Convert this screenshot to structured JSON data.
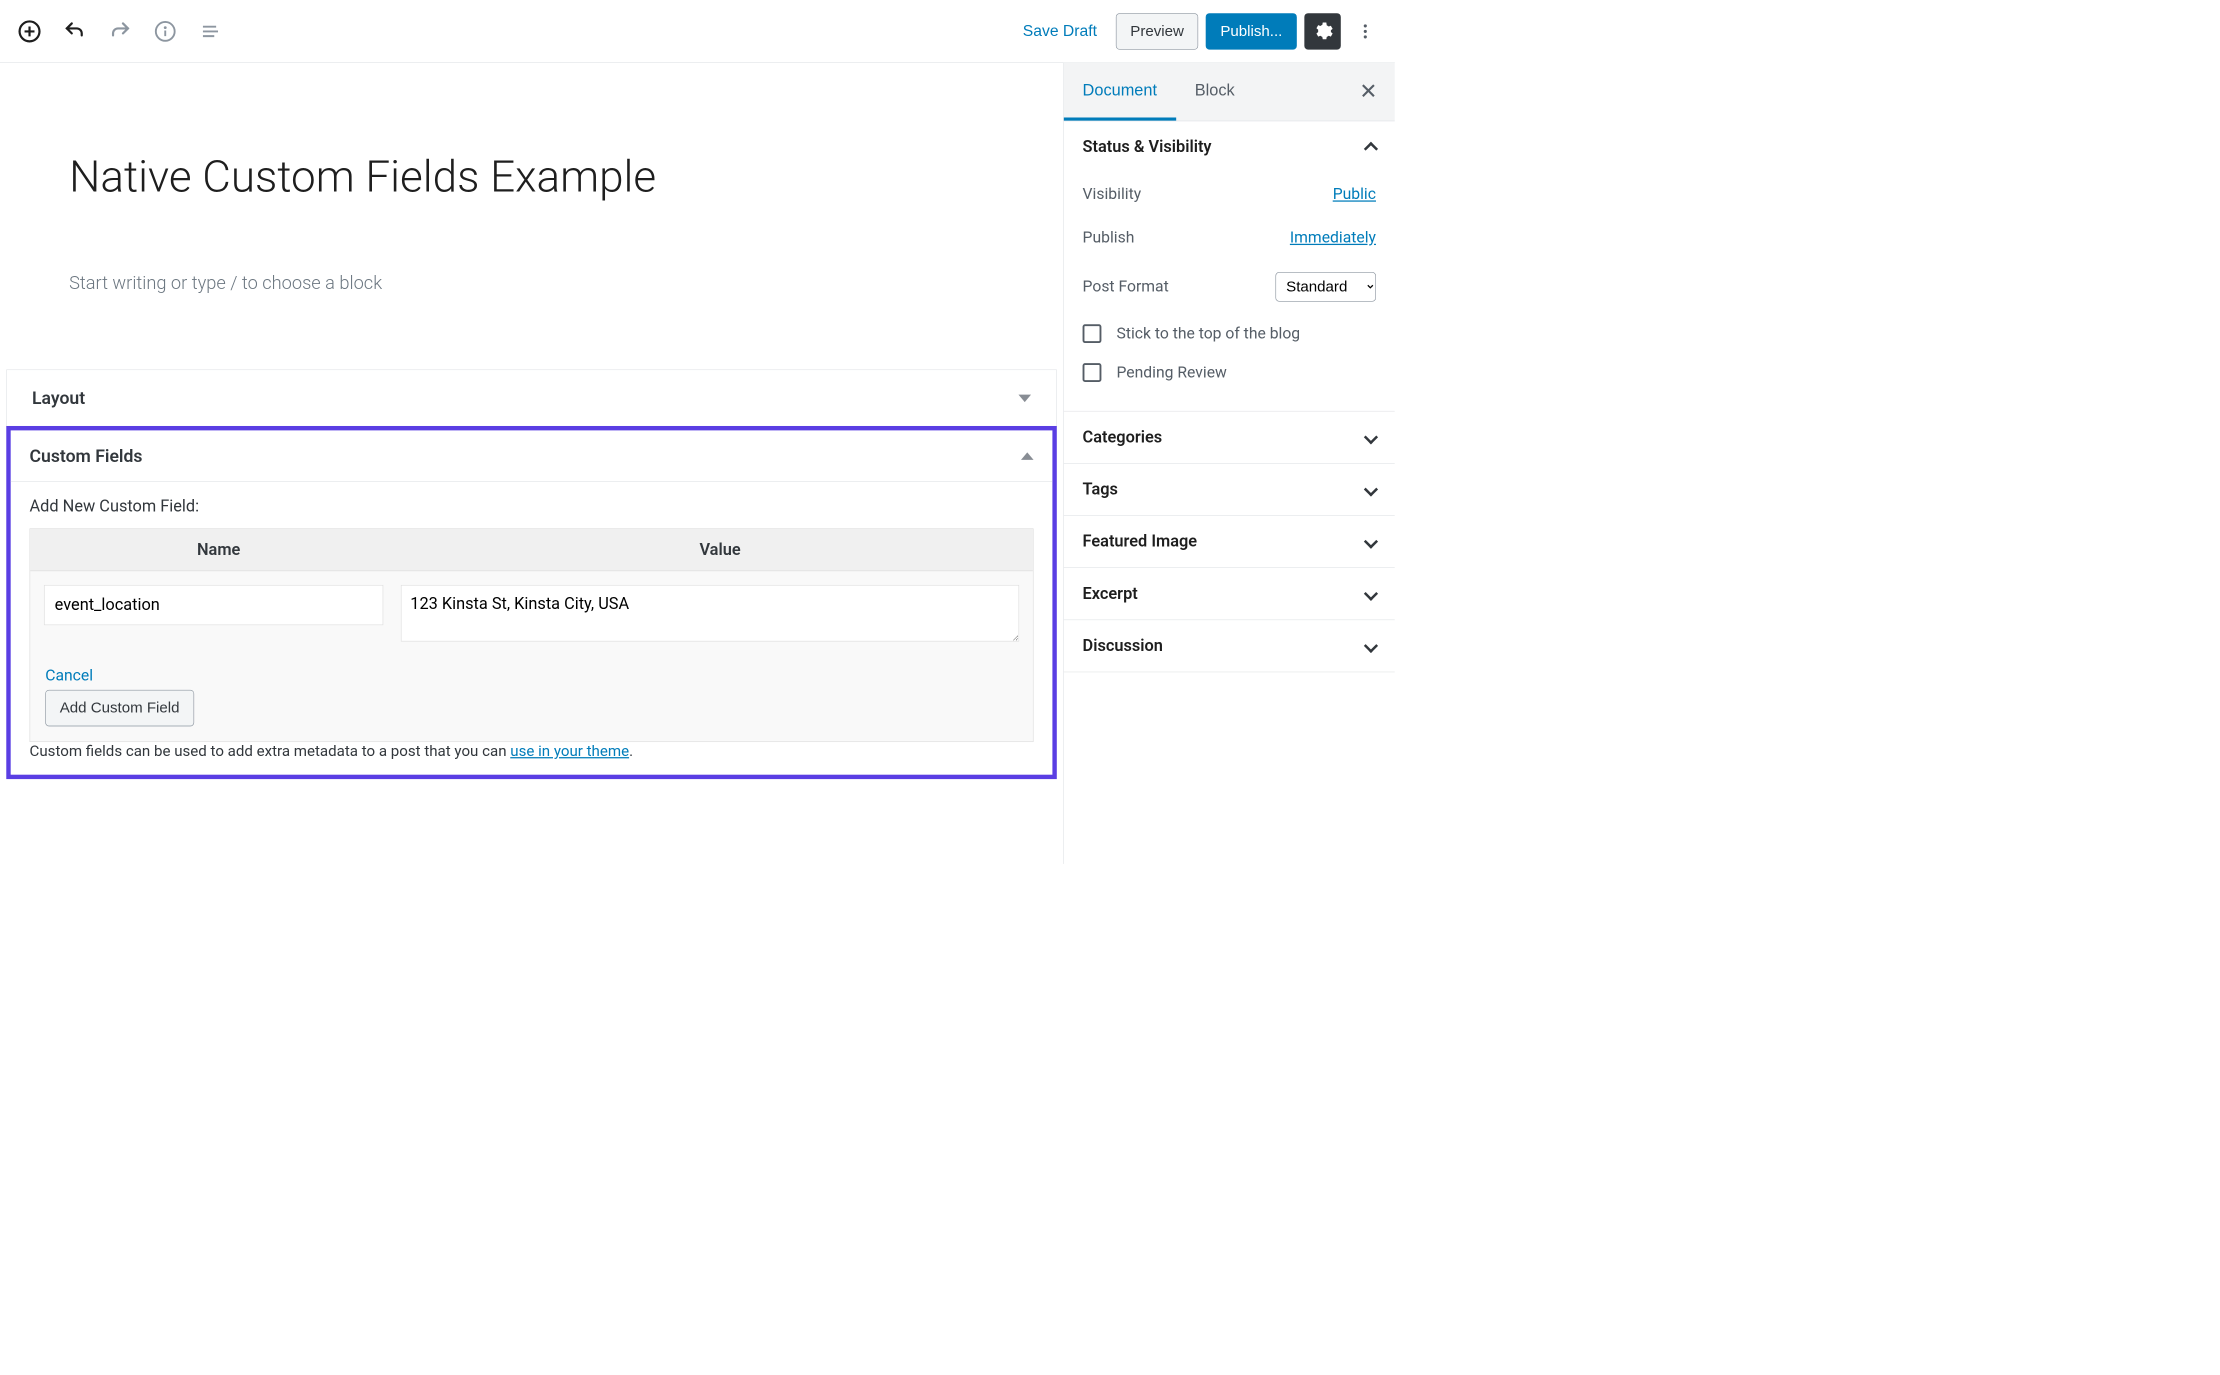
{
  "toolbar": {
    "save_draft": "Save Draft",
    "preview": "Preview",
    "publish": "Publish..."
  },
  "editor": {
    "title": "Native Custom Fields Example",
    "placeholder": "Start writing or type / to choose a block"
  },
  "meta": {
    "layout_label": "Layout",
    "cf_label": "Custom Fields",
    "cf_add_new": "Add New Custom Field:",
    "cf_col_name": "Name",
    "cf_col_value": "Value",
    "cf_name_value": "event_location",
    "cf_value_value": "123 Kinsta St, Kinsta City, USA",
    "cf_cancel": "Cancel",
    "cf_add_button": "Add Custom Field",
    "cf_help_text": "Custom fields can be used to add extra metadata to a post that you can ",
    "cf_help_link": "use in your theme",
    "cf_help_suffix": "."
  },
  "sidebar": {
    "tabs": {
      "document": "Document",
      "block": "Block"
    },
    "status": {
      "title": "Status & Visibility",
      "visibility_label": "Visibility",
      "visibility_value": "Public",
      "publish_label": "Publish",
      "publish_value": "Immediately",
      "format_label": "Post Format",
      "format_value": "Standard",
      "stick": "Stick to the top of the blog",
      "pending": "Pending Review"
    },
    "panels": {
      "categories": "Categories",
      "tags": "Tags",
      "featured": "Featured Image",
      "excerpt": "Excerpt",
      "discussion": "Discussion"
    }
  }
}
